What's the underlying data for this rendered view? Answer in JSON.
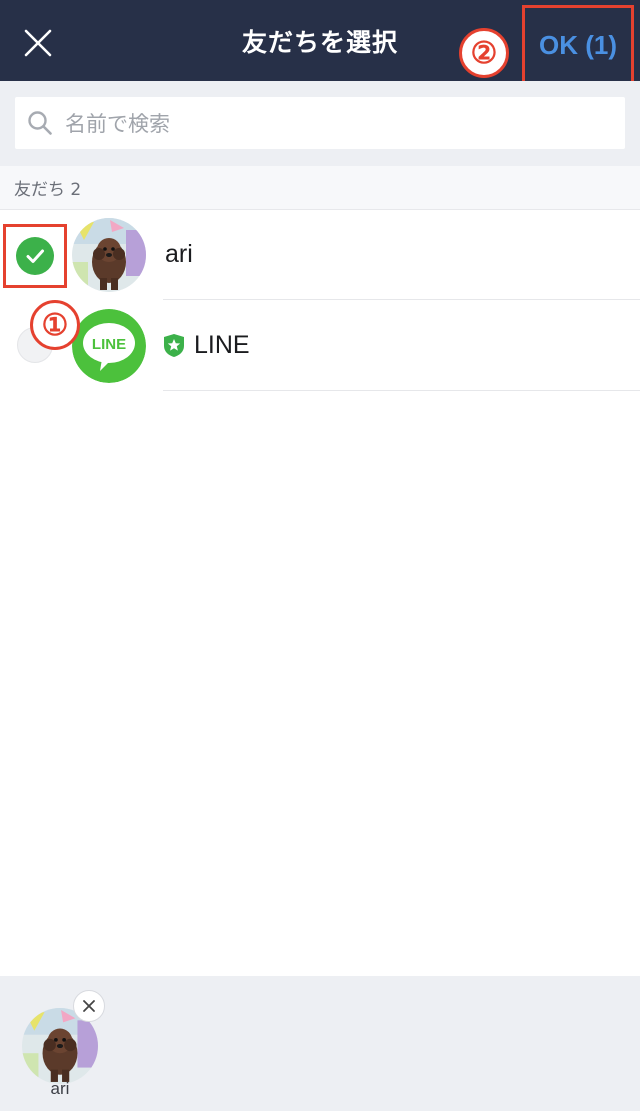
{
  "header": {
    "title": "友だちを選択",
    "ok_label": "OK (1)",
    "close_icon": "close-icon",
    "background": "#273048",
    "ok_color": "#4a90e2"
  },
  "annotations": {
    "step_one": "①",
    "step_two": "②",
    "color": "#e5412f"
  },
  "search": {
    "placeholder": "名前で検索",
    "icon": "search-icon"
  },
  "section": {
    "label": "友だち 2"
  },
  "friends": [
    {
      "name": "ari",
      "selected": true,
      "avatar": "dog-photo"
    },
    {
      "name": "LINE",
      "selected": false,
      "avatar": "line-logo",
      "logo_text": "LINE",
      "official_badge": "shield-star-icon"
    }
  ],
  "selected_tray": [
    {
      "name": "ari",
      "remove_icon": "close-icon"
    }
  ],
  "colors": {
    "check_green": "#3cb14a",
    "line_green": "#4cc13c",
    "tray_background": "#edeff3"
  }
}
